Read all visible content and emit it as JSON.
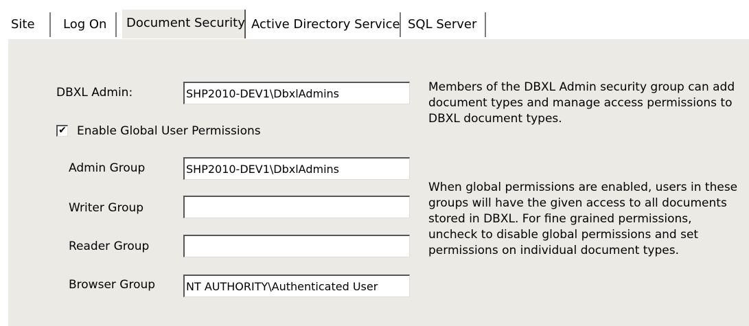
{
  "tabs": [
    {
      "label": "Site",
      "active": false
    },
    {
      "label": "Log On",
      "active": false
    },
    {
      "label": "Document Security",
      "active": true
    },
    {
      "label": "Active Directory Service",
      "active": false
    },
    {
      "label": "SQL Server",
      "active": false
    }
  ],
  "dbxl_admin": {
    "label": "DBXL Admin:",
    "value": "SHP2010-DEV1\\DbxlAdmins"
  },
  "global_permissions": {
    "label": "Enable Global User Permissions",
    "checked": true,
    "check_glyph": "✔"
  },
  "groups": {
    "admin": {
      "label": "Admin Group",
      "value": "SHP2010-DEV1\\DbxlAdmins"
    },
    "writer": {
      "label": "Writer Group",
      "value": ""
    },
    "reader": {
      "label": "Reader Group",
      "value": ""
    },
    "browser": {
      "label": "Browser Group",
      "value": "NT AUTHORITY\\Authenticated User"
    }
  },
  "descriptions": {
    "admin_help": "Members of the DBXL Admin security group can add document types and manage access permissions to DBXL document types.",
    "global_help": "When global permissions are enabled, users in these groups will have the given access to all documents stored in DBXL. For fine grained permissions,  uncheck to disable global permissions and set permissions on individual document types."
  },
  "colors": {
    "panel_background": "#ebeae5",
    "field_background": "#ffffff"
  }
}
